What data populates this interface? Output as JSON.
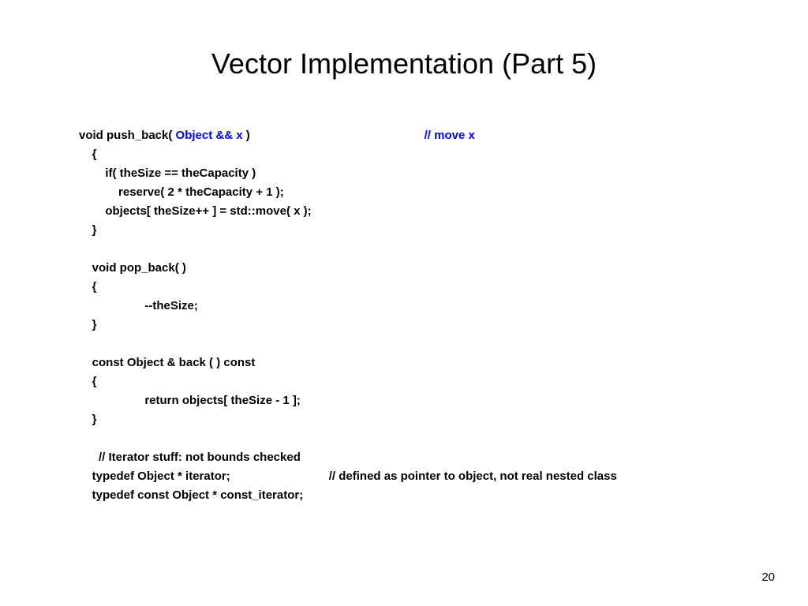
{
  "title": "Vector Implementation (Part 5)",
  "code": {
    "line1a": "void push_back( ",
    "line1b": "Object && x",
    "line1c": " )",
    "comment1": "// move x",
    "line2": "    {",
    "line3": "        if( theSize == theCapacity )",
    "line4": "            reserve( 2 * theCapacity + 1 );",
    "line5": "        objects[ theSize++ ] = std::move( x );",
    "line6": "    }",
    "blank1": "",
    "line7": "    void pop_back( )",
    "line8": "    {",
    "line9": "                    --theSize;",
    "line10": "    }",
    "blank2": "",
    "line11": "    const Object & back ( ) const",
    "line12": "    {",
    "line13": "                    return objects[ theSize - 1 ];",
    "line14": "    }",
    "blank3": "",
    "line15": "      // Iterator stuff: not bounds checked",
    "line16": "    typedef Object * iterator;",
    "comment2": "// defined as pointer to object, not real nested class",
    "line17": "    typedef const Object * const_iterator;"
  },
  "pageNumber": "20"
}
